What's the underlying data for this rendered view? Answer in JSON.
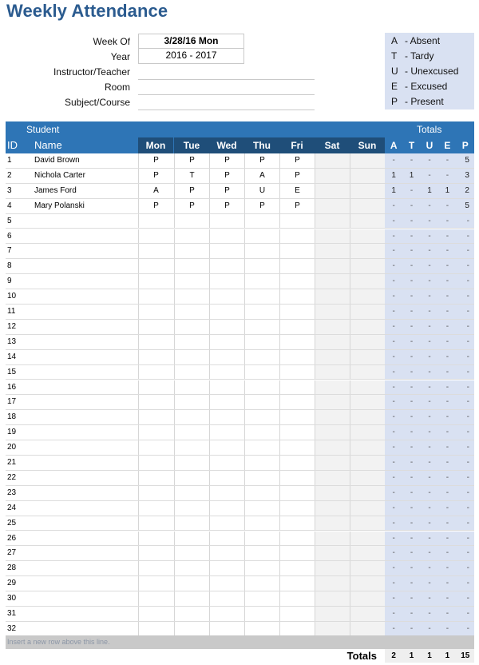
{
  "title": "Weekly Attendance",
  "info": {
    "week_of_label": "Week Of",
    "week_of_value": "3/28/16 Mon",
    "year_label": "Year",
    "year_value": "2016 - 2017",
    "instructor_label": "Instructor/Teacher",
    "instructor_value": "",
    "room_label": "Room",
    "room_value": "",
    "subject_label": "Subject/Course",
    "subject_value": ""
  },
  "legend": [
    {
      "code": "A",
      "desc": "- Absent"
    },
    {
      "code": "T",
      "desc": "- Tardy"
    },
    {
      "code": "U",
      "desc": "- Unexcused"
    },
    {
      "code": "E",
      "desc": "- Excused"
    },
    {
      "code": "P",
      "desc": "- Present"
    }
  ],
  "table": {
    "student_group_label": "Student",
    "totals_group_label": "Totals",
    "id_header": "ID",
    "name_header": "Name",
    "days": [
      "Mon",
      "Tue",
      "Wed",
      "Thu",
      "Fri",
      "Sat",
      "Sun"
    ],
    "total_codes": [
      "A",
      "T",
      "U",
      "E",
      "P"
    ],
    "rows": [
      {
        "id": "1",
        "name": "David Brown",
        "days": [
          "P",
          "P",
          "P",
          "P",
          "P",
          "",
          ""
        ],
        "totals": [
          "-",
          "-",
          "-",
          "-",
          "5"
        ]
      },
      {
        "id": "2",
        "name": "Nichola Carter",
        "days": [
          "P",
          "T",
          "P",
          "A",
          "P",
          "",
          ""
        ],
        "totals": [
          "1",
          "1",
          "-",
          "-",
          "3"
        ]
      },
      {
        "id": "3",
        "name": "James Ford",
        "days": [
          "A",
          "P",
          "P",
          "U",
          "E",
          "",
          ""
        ],
        "totals": [
          "1",
          "-",
          "1",
          "1",
          "2"
        ]
      },
      {
        "id": "4",
        "name": "Mary Polanski",
        "days": [
          "P",
          "P",
          "P",
          "P",
          "P",
          "",
          ""
        ],
        "totals": [
          "-",
          "-",
          "-",
          "-",
          "5"
        ]
      },
      {
        "id": "5",
        "name": "",
        "days": [
          "",
          "",
          "",
          "",
          "",
          "",
          ""
        ],
        "totals": [
          "-",
          "-",
          "-",
          "-",
          "-"
        ]
      },
      {
        "id": "6",
        "name": "",
        "days": [
          "",
          "",
          "",
          "",
          "",
          "",
          ""
        ],
        "totals": [
          "-",
          "-",
          "-",
          "-",
          "-"
        ]
      },
      {
        "id": "7",
        "name": "",
        "days": [
          "",
          "",
          "",
          "",
          "",
          "",
          ""
        ],
        "totals": [
          "-",
          "-",
          "-",
          "-",
          "-"
        ]
      },
      {
        "id": "8",
        "name": "",
        "days": [
          "",
          "",
          "",
          "",
          "",
          "",
          ""
        ],
        "totals": [
          "-",
          "-",
          "-",
          "-",
          "-"
        ]
      },
      {
        "id": "9",
        "name": "",
        "days": [
          "",
          "",
          "",
          "",
          "",
          "",
          ""
        ],
        "totals": [
          "-",
          "-",
          "-",
          "-",
          "-"
        ]
      },
      {
        "id": "10",
        "name": "",
        "days": [
          "",
          "",
          "",
          "",
          "",
          "",
          ""
        ],
        "totals": [
          "-",
          "-",
          "-",
          "-",
          "-"
        ]
      },
      {
        "id": "11",
        "name": "",
        "days": [
          "",
          "",
          "",
          "",
          "",
          "",
          ""
        ],
        "totals": [
          "-",
          "-",
          "-",
          "-",
          "-"
        ]
      },
      {
        "id": "12",
        "name": "",
        "days": [
          "",
          "",
          "",
          "",
          "",
          "",
          ""
        ],
        "totals": [
          "-",
          "-",
          "-",
          "-",
          "-"
        ]
      },
      {
        "id": "13",
        "name": "",
        "days": [
          "",
          "",
          "",
          "",
          "",
          "",
          ""
        ],
        "totals": [
          "-",
          "-",
          "-",
          "-",
          "-"
        ]
      },
      {
        "id": "14",
        "name": "",
        "days": [
          "",
          "",
          "",
          "",
          "",
          "",
          ""
        ],
        "totals": [
          "-",
          "-",
          "-",
          "-",
          "-"
        ]
      },
      {
        "id": "15",
        "name": "",
        "days": [
          "",
          "",
          "",
          "",
          "",
          "",
          ""
        ],
        "totals": [
          "-",
          "-",
          "-",
          "-",
          "-"
        ]
      },
      {
        "id": "16",
        "name": "",
        "days": [
          "",
          "",
          "",
          "",
          "",
          "",
          ""
        ],
        "totals": [
          "-",
          "-",
          "-",
          "-",
          "-"
        ]
      },
      {
        "id": "17",
        "name": "",
        "days": [
          "",
          "",
          "",
          "",
          "",
          "",
          ""
        ],
        "totals": [
          "-",
          "-",
          "-",
          "-",
          "-"
        ]
      },
      {
        "id": "18",
        "name": "",
        "days": [
          "",
          "",
          "",
          "",
          "",
          "",
          ""
        ],
        "totals": [
          "-",
          "-",
          "-",
          "-",
          "-"
        ]
      },
      {
        "id": "19",
        "name": "",
        "days": [
          "",
          "",
          "",
          "",
          "",
          "",
          ""
        ],
        "totals": [
          "-",
          "-",
          "-",
          "-",
          "-"
        ]
      },
      {
        "id": "20",
        "name": "",
        "days": [
          "",
          "",
          "",
          "",
          "",
          "",
          ""
        ],
        "totals": [
          "-",
          "-",
          "-",
          "-",
          "-"
        ]
      },
      {
        "id": "21",
        "name": "",
        "days": [
          "",
          "",
          "",
          "",
          "",
          "",
          ""
        ],
        "totals": [
          "-",
          "-",
          "-",
          "-",
          "-"
        ]
      },
      {
        "id": "22",
        "name": "",
        "days": [
          "",
          "",
          "",
          "",
          "",
          "",
          ""
        ],
        "totals": [
          "-",
          "-",
          "-",
          "-",
          "-"
        ]
      },
      {
        "id": "23",
        "name": "",
        "days": [
          "",
          "",
          "",
          "",
          "",
          "",
          ""
        ],
        "totals": [
          "-",
          "-",
          "-",
          "-",
          "-"
        ]
      },
      {
        "id": "24",
        "name": "",
        "days": [
          "",
          "",
          "",
          "",
          "",
          "",
          ""
        ],
        "totals": [
          "-",
          "-",
          "-",
          "-",
          "-"
        ]
      },
      {
        "id": "25",
        "name": "",
        "days": [
          "",
          "",
          "",
          "",
          "",
          "",
          ""
        ],
        "totals": [
          "-",
          "-",
          "-",
          "-",
          "-"
        ]
      },
      {
        "id": "26",
        "name": "",
        "days": [
          "",
          "",
          "",
          "",
          "",
          "",
          ""
        ],
        "totals": [
          "-",
          "-",
          "-",
          "-",
          "-"
        ]
      },
      {
        "id": "27",
        "name": "",
        "days": [
          "",
          "",
          "",
          "",
          "",
          "",
          ""
        ],
        "totals": [
          "-",
          "-",
          "-",
          "-",
          "-"
        ]
      },
      {
        "id": "28",
        "name": "",
        "days": [
          "",
          "",
          "",
          "",
          "",
          "",
          ""
        ],
        "totals": [
          "-",
          "-",
          "-",
          "-",
          "-"
        ]
      },
      {
        "id": "29",
        "name": "",
        "days": [
          "",
          "",
          "",
          "",
          "",
          "",
          ""
        ],
        "totals": [
          "-",
          "-",
          "-",
          "-",
          "-"
        ]
      },
      {
        "id": "30",
        "name": "",
        "days": [
          "",
          "",
          "",
          "",
          "",
          "",
          ""
        ],
        "totals": [
          "-",
          "-",
          "-",
          "-",
          "-"
        ]
      },
      {
        "id": "31",
        "name": "",
        "days": [
          "",
          "",
          "",
          "",
          "",
          "",
          ""
        ],
        "totals": [
          "-",
          "-",
          "-",
          "-",
          "-"
        ]
      },
      {
        "id": "32",
        "name": "",
        "days": [
          "",
          "",
          "",
          "",
          "",
          "",
          ""
        ],
        "totals": [
          "-",
          "-",
          "-",
          "-",
          "-"
        ]
      }
    ],
    "insert_row_text": "Insert a new row above this line.",
    "grand_totals_label": "Totals",
    "grand_totals": [
      "2",
      "1",
      "1",
      "1",
      "15"
    ]
  },
  "colors": {
    "header_blue": "#2e75b6",
    "day_header_dark": "#1f4e79",
    "totals_bg": "#d9e1f2",
    "title": "#2b5b8f"
  }
}
